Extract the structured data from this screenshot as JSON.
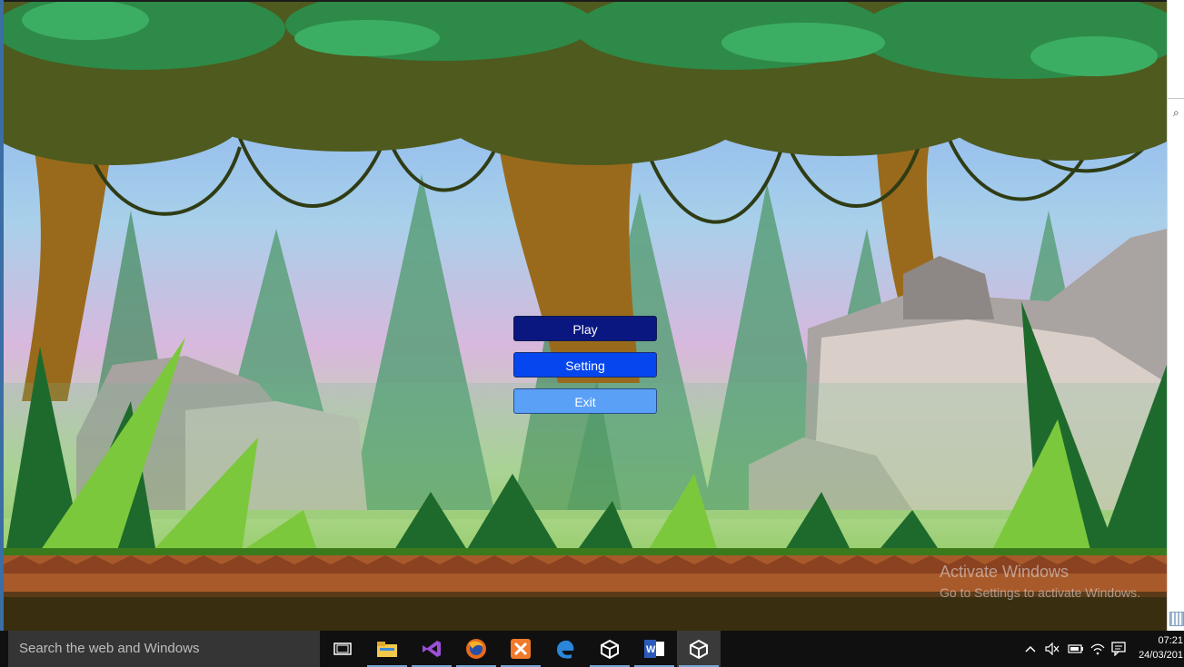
{
  "menu": {
    "play_label": "Play",
    "setting_label": "Setting",
    "exit_label": "Exit"
  },
  "watermark": {
    "title": "Activate Windows",
    "subtitle": "Go to Settings to activate Windows."
  },
  "taskbar": {
    "search_placeholder": "Search the web and Windows",
    "apps": [
      "task-view",
      "file-explorer",
      "visual-studio",
      "firefox",
      "xampp",
      "edge",
      "unity",
      "word",
      "unity"
    ],
    "time": "07:21",
    "date": "24/03/201"
  },
  "colors": {
    "play": "#0b1780",
    "setting": "#0646ee",
    "exit": "#5aa0f7",
    "taskbar": "#101010"
  }
}
